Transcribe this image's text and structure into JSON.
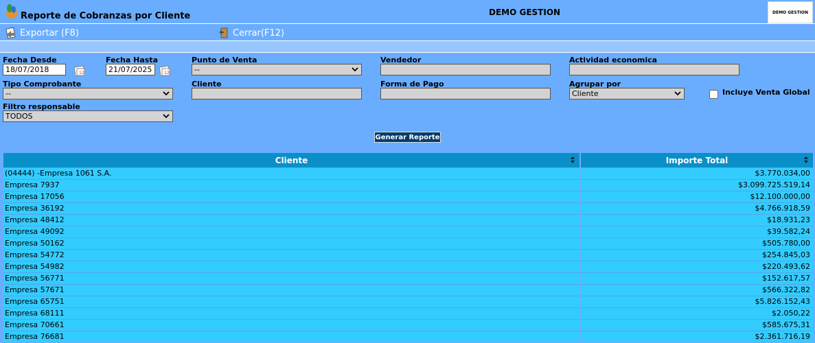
{
  "header": {
    "title": "Reporte de Cobranzas por Cliente",
    "company": "DEMO GESTION",
    "logo_text": "DEMO GESTION"
  },
  "toolbar": {
    "export_label": "Exportar (F8)",
    "close_label": "Cerrar(F12)"
  },
  "filters": {
    "fecha_desde": {
      "label": "Fecha Desde",
      "value": "18/07/2018"
    },
    "fecha_hasta": {
      "label": "Fecha Hasta",
      "value": "21/07/2025"
    },
    "punto_venta": {
      "label": "Punto de Venta",
      "value": "--"
    },
    "vendedor": {
      "label": "Vendedor",
      "value": ""
    },
    "actividad": {
      "label": "Actividad economica",
      "value": ""
    },
    "tipo_comprobante": {
      "label": "Tipo Comprobante",
      "value": "--"
    },
    "cliente": {
      "label": "Cliente",
      "value": ""
    },
    "forma_pago": {
      "label": "Forma de Pago",
      "value": ""
    },
    "agrupar": {
      "label": "Agrupar por",
      "value": "Cliente"
    },
    "venta_global": {
      "label": "Incluye Venta Global",
      "checked": false
    },
    "filtro_responsable": {
      "label": "Filtro responsable",
      "value": "TODOS"
    }
  },
  "generate_label": "Generar Reporte",
  "table": {
    "columns": [
      "Cliente",
      "Importe Total"
    ],
    "rows": [
      [
        "(04444) -Empresa 1061 S.A.",
        "$3.770.034,00"
      ],
      [
        "Empresa 7937",
        "$3.099.725.519,14"
      ],
      [
        "Empresa 17056",
        "$12.100.000,00"
      ],
      [
        "Empresa 36192",
        "$4.766.918,59"
      ],
      [
        "Empresa 48412",
        "$18.931,23"
      ],
      [
        "Empresa 49092",
        "$39.582,24"
      ],
      [
        "Empresa 50162",
        "$505.780,00"
      ],
      [
        "Empresa 54772",
        "$254.845,03"
      ],
      [
        "Empresa 54982",
        "$220.493,62"
      ],
      [
        "Empresa 56771",
        "$152.617,57"
      ],
      [
        "Empresa 57671",
        "$566.322,82"
      ],
      [
        "Empresa 65751",
        "$5.826.152,43"
      ],
      [
        "Empresa 68111",
        "$2.050,22"
      ],
      [
        "Empresa 70661",
        "$585.675,31"
      ],
      [
        "Empresa 76681",
        "$2.361.716,19"
      ]
    ]
  }
}
